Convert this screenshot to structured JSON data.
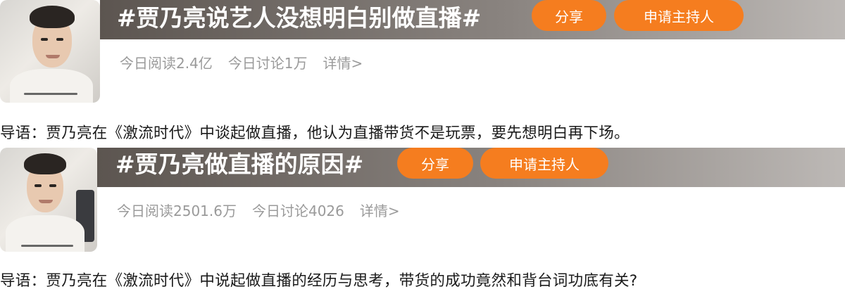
{
  "topics": [
    {
      "title": "#贾乃亮说艺人没想明白别做直播#",
      "share_label": "分享",
      "host_label": "申请主持人",
      "read_label": "今日阅读2.4亿",
      "discuss_label": "今日讨论1万",
      "detail_label": "详情>",
      "lead": "导语：贾乃亮在《激流时代》中谈起做直播，他认为直播带货不是玩票，要先想明白再下场。"
    },
    {
      "title": "#贾乃亮做直播的原因#",
      "share_label": "分享",
      "host_label": "申请主持人",
      "read_label": "今日阅读2501.6万",
      "discuss_label": "今日讨论4026",
      "detail_label": "详情>",
      "lead": "导语：贾乃亮在《激流时代》中说起做直播的经历与思考，带货的成功竟然和背台词功底有关?"
    }
  ],
  "colors": {
    "accent": "#f57d1f",
    "title_bar": "#6e6863",
    "stat_text": "#9a9a9a"
  }
}
